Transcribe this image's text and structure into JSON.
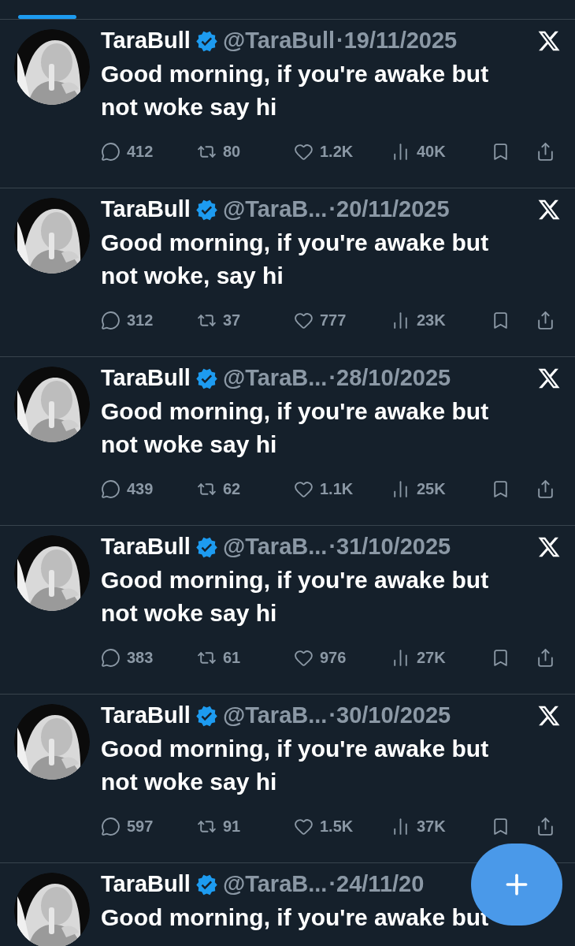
{
  "tabs_indicator": {
    "selected": true
  },
  "tweets": [
    {
      "name": "TaraBull",
      "verified": true,
      "handle": "@TaraBull",
      "date": "·19/11/2025",
      "x_logo": true,
      "text": "Good morning, if you're awake but not woke say hi",
      "stats": {
        "replies": "412",
        "reposts": "80",
        "likes": "1.2K",
        "views": "40K"
      }
    },
    {
      "name": "TaraBull",
      "verified": true,
      "handle": "@TaraB...",
      "date": "·20/11/2025",
      "x_logo": true,
      "text": "Good morning, if you're awake but not woke, say hi",
      "stats": {
        "replies": "312",
        "reposts": "37",
        "likes": "777",
        "views": "23K"
      }
    },
    {
      "name": "TaraBull",
      "verified": true,
      "handle": "@TaraB...",
      "date": "·28/10/2025",
      "x_logo": true,
      "text": "Good morning, if you're awake but not woke say hi",
      "stats": {
        "replies": "439",
        "reposts": "62",
        "likes": "1.1K",
        "views": "25K"
      }
    },
    {
      "name": "TaraBull",
      "verified": true,
      "handle": "@TaraB...",
      "date": "·31/10/2025",
      "x_logo": true,
      "text": "Good morning, if you're awake but not woke say hi",
      "stats": {
        "replies": "383",
        "reposts": "61",
        "likes": "976",
        "views": "27K"
      }
    },
    {
      "name": "TaraBull",
      "verified": true,
      "handle": "@TaraB...",
      "date": "·30/10/2025",
      "x_logo": true,
      "text": "Good morning, if you're awake but not woke say hi",
      "stats": {
        "replies": "597",
        "reposts": "91",
        "likes": "1.5K",
        "views": "37K"
      }
    },
    {
      "name": "TaraBull",
      "verified": true,
      "handle": "@TaraB...",
      "date": "·24/11/20",
      "text": "Good morning, if you're awake but"
    }
  ]
}
